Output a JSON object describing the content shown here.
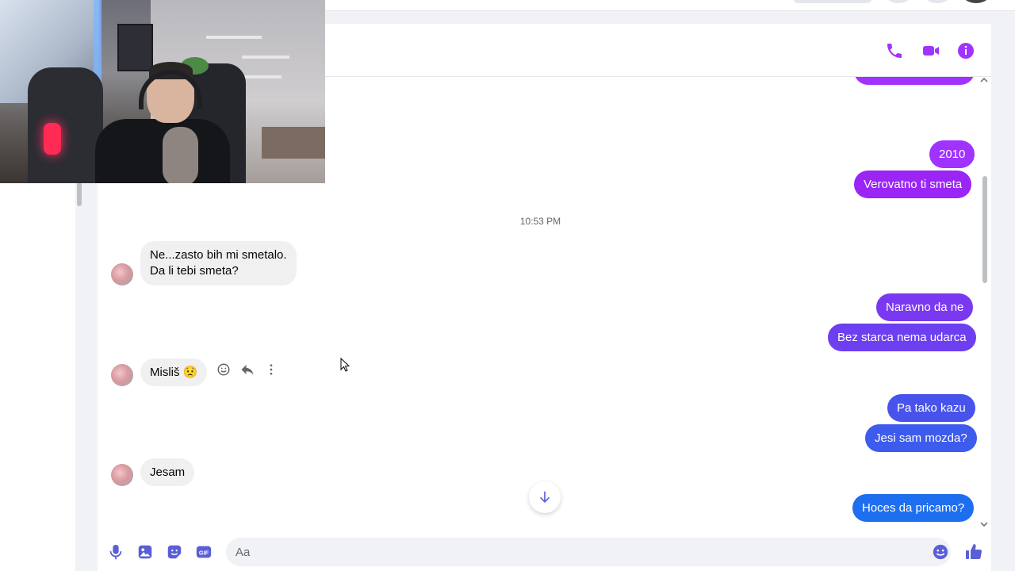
{
  "header": {
    "call_icon": "phone-icon",
    "video_icon": "video-camera-icon",
    "info_icon": "info-icon",
    "accent_color": "#a033ff"
  },
  "messages": {
    "timestamp": "10:53 PM",
    "outgoing": [
      {
        "text": "2010",
        "color": "#a033ff"
      },
      {
        "text": "Verovatno ti smeta",
        "color": "#9a25f5"
      },
      {
        "text": "Naravno da ne",
        "color": "#7a39f0"
      },
      {
        "text": "Bez starca nema udarca",
        "color": "#6d3ff0"
      },
      {
        "text": "Pa tako kazu",
        "color": "#4853ec"
      },
      {
        "text": "Jesi sam mozda?",
        "color": "#3d5bec"
      },
      {
        "text": "Hoces da pricamo?",
        "color": "#1e6ff0"
      }
    ],
    "incoming": [
      {
        "line1": "Ne...zasto bih mi smetalo.",
        "line2": "Da li tebi smeta?"
      },
      {
        "text": "Misliš",
        "emoji": "😟"
      },
      {
        "text": "Jesam"
      }
    ]
  },
  "message_actions": {
    "react_icon": "smiley-icon",
    "reply_icon": "reply-icon",
    "more_icon": "more-vertical-icon"
  },
  "composer": {
    "placeholder": "Aa",
    "value": "",
    "mic_icon": "microphone-icon",
    "image_icon": "image-icon",
    "sticker_icon": "sticker-icon",
    "gif_label": "GIF",
    "emoji_icon": "emoji-icon",
    "like_icon": "thumbs-up-icon"
  },
  "jump_icon": "arrow-down-icon"
}
